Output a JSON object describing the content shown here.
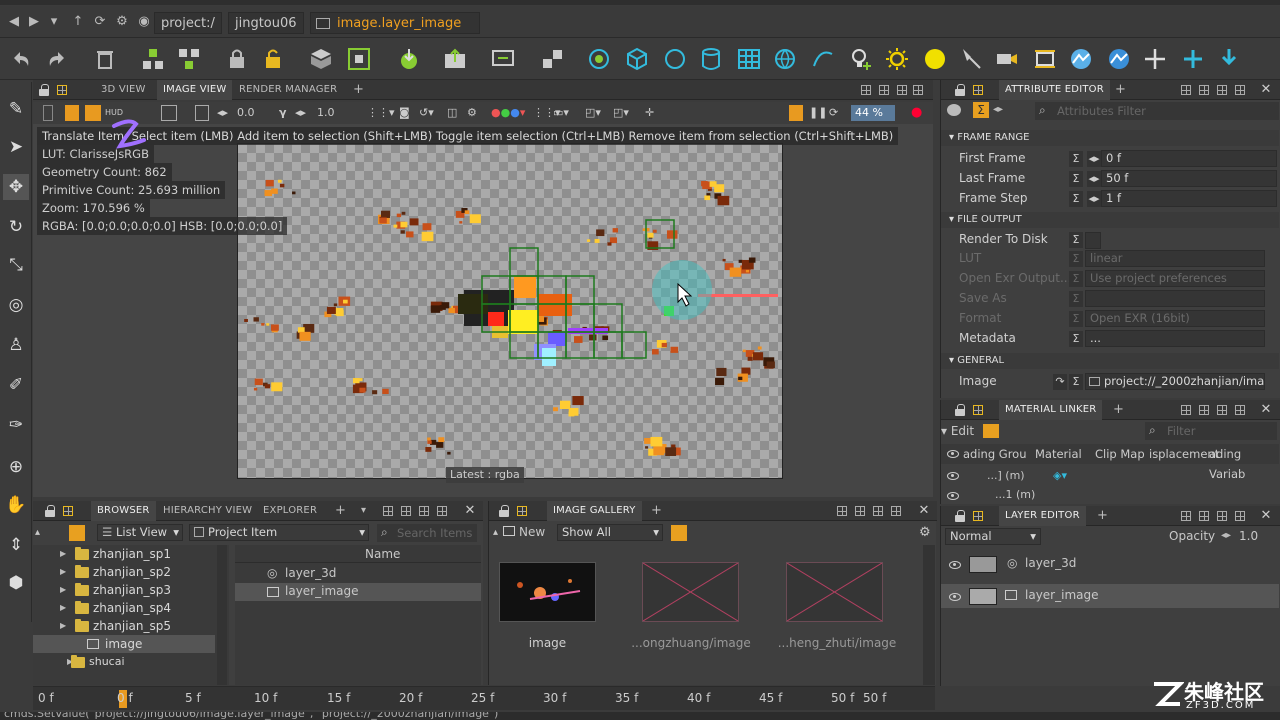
{
  "path": {
    "segments": [
      "project:/",
      "jingtou06",
      "image.layer_image"
    ]
  },
  "viewport_tabs": [
    "3D VIEW",
    "IMAGE VIEW",
    "RENDER MANAGER"
  ],
  "viewport": {
    "exposure": "0.0",
    "gamma": "1.0",
    "zoom_pct": "44 %",
    "hint": "Translate Item: Select item (LMB)  Add item to selection (Shift+LMB)  Toggle item selection (Ctrl+LMB)  Remove item from selection (Ctrl+Shift+LMB)",
    "info": [
      "LUT: ClarisseJsRGB",
      "Geometry Count: 862",
      "Primitive Count: 25.693 million",
      "Zoom: 170.596 %",
      "RGBA: [0.0;0.0;0.0;0.0] HSB: [0.0;0.0;0.0]"
    ],
    "footer": "Latest : rgba"
  },
  "attribute_editor": {
    "tab": "ATTRIBUTE EDITOR",
    "filter_placeholder": "Attributes Filter",
    "sections": {
      "frame_range": "FRAME RANGE",
      "file_output": "FILE OUTPUT",
      "general": "GENERAL"
    },
    "first_frame_label": "First Frame",
    "first_frame": "0 f",
    "last_frame_label": "Last Frame",
    "last_frame": "50 f",
    "frame_step_label": "Frame Step",
    "frame_step": "1 f",
    "render_to_disk_label": "Render To Disk",
    "lut_label": "LUT",
    "lut": "linear",
    "open_exr_label": "Open Exr Output...",
    "open_exr": "Use project preferences",
    "save_as_label": "Save As",
    "format_label": "Format",
    "format": "Open EXR (16bit)",
    "metadata_label": "Metadata",
    "metadata": "...",
    "image_label": "Image",
    "image": "project://_2000zhanjian/image"
  },
  "material_linker": {
    "tab": "MATERIAL LINKER",
    "edit": "Edit",
    "filter_placeholder": "Filter",
    "columns": [
      "ading Grou",
      "Material",
      "Clip Map",
      "isplacement",
      "ading Variab"
    ],
    "rows": [
      "...] (m)",
      "...1 (m)"
    ]
  },
  "layer_editor": {
    "tab": "LAYER EDITOR",
    "blend": "Normal",
    "opacity_label": "Opacity",
    "opacity": "1.0",
    "layers": [
      "layer_3d",
      "layer_image"
    ]
  },
  "browser": {
    "tabs": [
      "BROWSER",
      "HIERARCHY VIEW",
      "EXPLORER"
    ],
    "view_mode": "List View",
    "item_type": "Project Item",
    "search_placeholder": "Search Items",
    "tree": [
      "zhanjian_sp1",
      "zhanjian_sp2",
      "zhanjian_sp3",
      "zhanjian_sp4",
      "zhanjian_sp5",
      "image",
      "shucai"
    ],
    "list_header": "Name",
    "list": [
      "layer_3d",
      "layer_image"
    ]
  },
  "gallery": {
    "tab": "IMAGE GALLERY",
    "new": "New",
    "show": "Show All",
    "items": [
      "image",
      "...ongzhuang/image",
      "...heng_zhuti/image"
    ]
  },
  "timeline": {
    "ticks": [
      "0 f",
      "0 f",
      "5 f",
      "10 f",
      "15 f",
      "20 f",
      "25 f",
      "30 f",
      "35 f",
      "40 f",
      "45 f",
      "50 f",
      "50 f"
    ]
  },
  "status": "cmds.SetValue(\"project://jingtou06/image.layer_image\", \"project://_2000zhanjian/image\")",
  "watermark": {
    "brand": "朱峰社区",
    "site": "ZF3D.COM"
  },
  "colors": {
    "accent": "#f0a020",
    "bg": "#3b3b3b",
    "panel": "#3f3f3f"
  }
}
